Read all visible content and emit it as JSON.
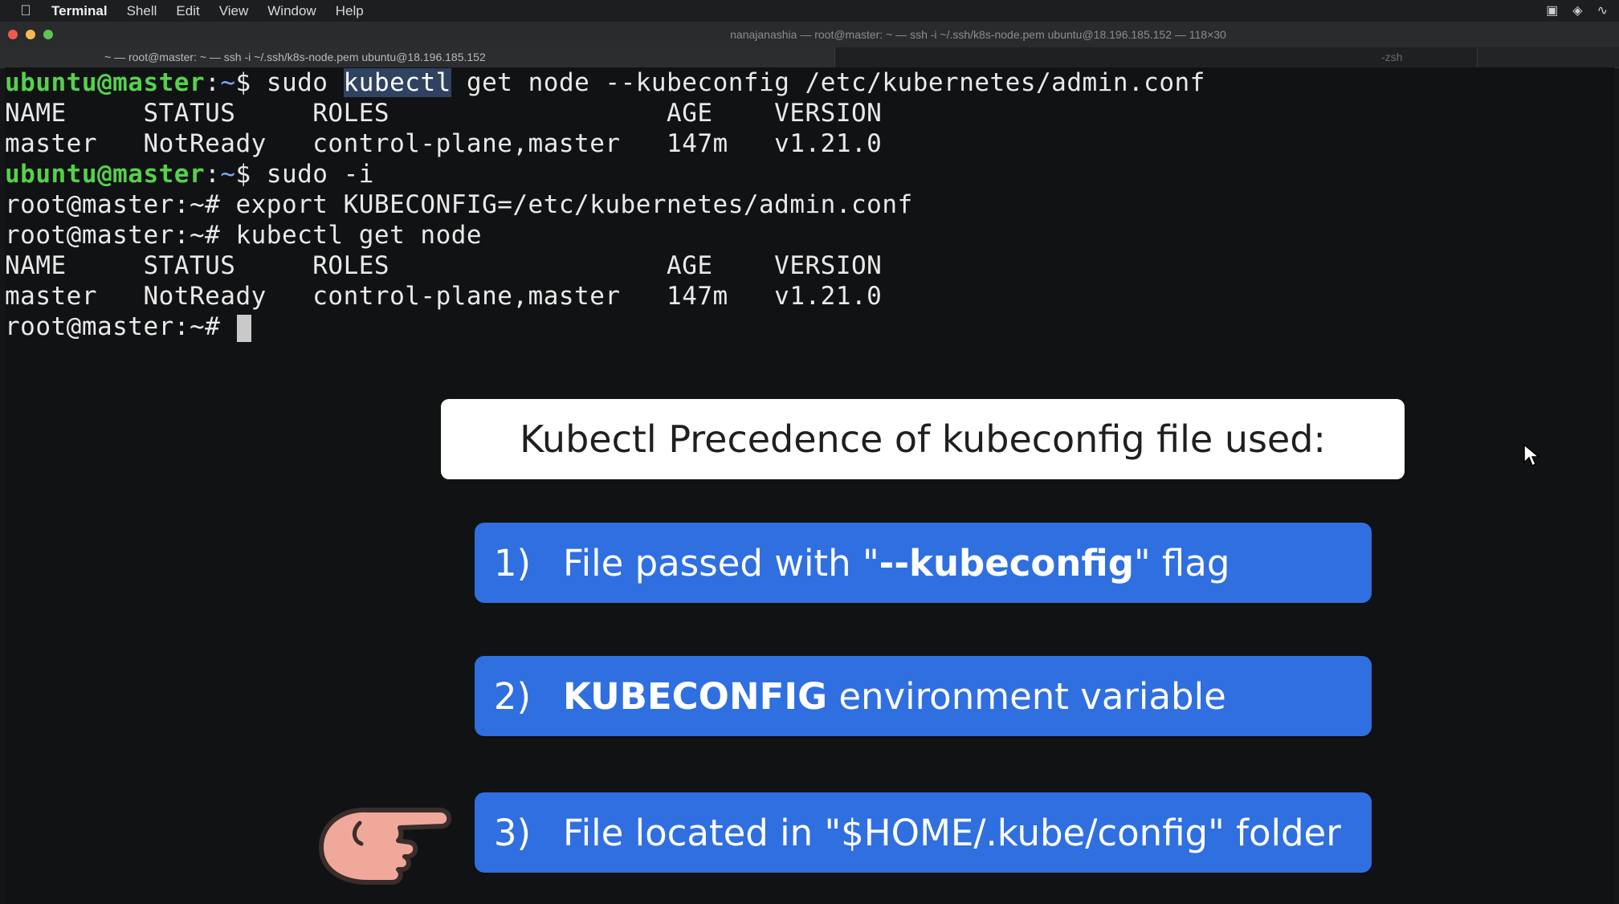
{
  "menubar": {
    "app": "Terminal",
    "items": [
      "Shell",
      "Edit",
      "View",
      "Window",
      "Help"
    ]
  },
  "window": {
    "title": "nanajanashia — root@master: ~ — ssh -i ~/.ssh/k8s-node.pem ubuntu@18.196.185.152 — 118×30",
    "tabs": [
      "~ — root@master: ~ — ssh -i ~/.ssh/k8s-node.pem ubuntu@18.196.185.152",
      "-zsh"
    ]
  },
  "terminal": {
    "lines": {
      "l1": {
        "user": "ubuntu@master",
        "sep": ":",
        "path": "~",
        "prompt": "$ ",
        "cmd1": "sudo ",
        "sel": "kubectl",
        "cmd2": " get node --kubeconfig /etc/kubernetes/admin.conf"
      },
      "l2": "NAME     STATUS     ROLES                  AGE    VERSION",
      "l3": "master   NotReady   control-plane,master   147m   v1.21.0",
      "l4": {
        "user": "ubuntu@master",
        "sep": ":",
        "path": "~",
        "prompt": "$ ",
        "cmd": "sudo -i"
      },
      "l5": "root@master:~# export KUBECONFIG=/etc/kubernetes/admin.conf",
      "l6": "root@master:~# kubectl get node",
      "l7": "NAME     STATUS     ROLES                  AGE    VERSION",
      "l8": "master   NotReady   control-plane,master   147m   v1.21.0",
      "l9": "root@master:~# "
    }
  },
  "slide": {
    "header": "Kubectl Precedence of kubeconfig file used:",
    "items": [
      {
        "num": "1)",
        "pre": "File passed with \"",
        "bold": "--kubeconfig",
        "post": "\" flag"
      },
      {
        "num": "2)",
        "pre": "",
        "bold": "KUBECONFIG",
        "post": " environment variable"
      },
      {
        "num": "3)",
        "pre": "File located in \"$HOME/.kube/config\" folder",
        "bold": "",
        "post": ""
      }
    ]
  },
  "icons": {
    "hand": "pointing-hand-icon",
    "pointer": "mouse-pointer-icon"
  },
  "colors": {
    "prompt_green": "#55d24b",
    "card_blue": "#2f6fe0"
  }
}
